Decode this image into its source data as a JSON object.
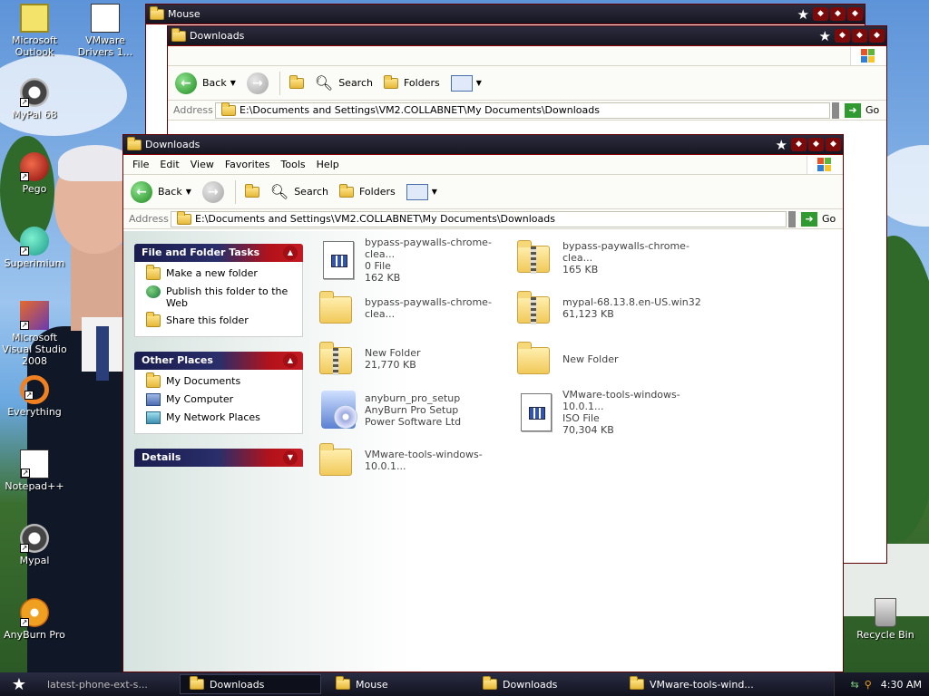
{
  "desktop_icons": [
    {
      "label": "Microsoft Outlook"
    },
    {
      "label": "VMware Drivers 1..."
    },
    {
      "label": "MyPal 68"
    },
    {
      "label": "Pego"
    },
    {
      "label": "Superimium"
    },
    {
      "label": "Microsoft Visual Studio 2008"
    },
    {
      "label": "Everything"
    },
    {
      "label": "Notepad++"
    },
    {
      "label": "Mypal"
    },
    {
      "label": "AnyBurn Pro"
    },
    {
      "label": "Recycle Bin"
    }
  ],
  "bg_windows": [
    {
      "title": "Mouse"
    },
    {
      "title": "Downloads",
      "back": "Back",
      "search": "Search",
      "folders": "Folders",
      "address_label": "Address",
      "address": "E:\\Documents and Settings\\VM2.COLLABNET\\My Documents\\Downloads",
      "go": "Go"
    }
  ],
  "window": {
    "title": "Downloads",
    "menu": [
      "File",
      "Edit",
      "View",
      "Favorites",
      "Tools",
      "Help"
    ],
    "toolbar": {
      "back": "Back",
      "search": "Search",
      "folders": "Folders"
    },
    "address_label": "Address",
    "address": "E:\\Documents and Settings\\VM2.COLLABNET\\My Documents\\Downloads",
    "go": "Go"
  },
  "taskpane": {
    "file_tasks": {
      "title": "File and Folder Tasks",
      "items": [
        "Make a new folder",
        "Publish this folder to the Web",
        "Share this folder"
      ]
    },
    "other_places": {
      "title": "Other Places",
      "items": [
        "My Documents",
        "My Computer",
        "My Network Places"
      ]
    },
    "details": {
      "title": "Details"
    }
  },
  "files": [
    {
      "name": "bypass-paywalls-chrome-clea...",
      "line2": "0 File",
      "line3": "162 KB",
      "icon": "document-icon"
    },
    {
      "name": "bypass-paywalls-chrome-clea...",
      "line2": "165 KB",
      "line3": "",
      "icon": "zip-folder-icon"
    },
    {
      "name": "bypass-paywalls-chrome-clea...",
      "line2": "",
      "line3": "",
      "icon": "folder-icon"
    },
    {
      "name": "mypal-68.13.8.en-US.win32",
      "line2": "61,123 KB",
      "line3": "",
      "icon": "zip-folder-icon"
    },
    {
      "name": "New Folder",
      "line2": "21,770 KB",
      "line3": "",
      "icon": "zip-folder-icon"
    },
    {
      "name": "New Folder",
      "line2": "",
      "line3": "",
      "icon": "folder-icon"
    },
    {
      "name": "anyburn_pro_setup",
      "line2": "AnyBurn Pro Setup",
      "line3": "Power Software Ltd",
      "icon": "setup-icon"
    },
    {
      "name": "VMware-tools-windows-10.0.1...",
      "line2": "ISO File",
      "line3": "70,304 KB",
      "icon": "document-icon"
    },
    {
      "name": "VMware-tools-windows-10.0.1...",
      "line2": "",
      "line3": "",
      "icon": "folder-icon"
    }
  ],
  "taskbar": {
    "buttons": [
      "latest-phone-ext-s...",
      "Downloads",
      "Mouse",
      "Downloads",
      "VMware-tools-wind..."
    ],
    "clock": "4:30 AM"
  }
}
